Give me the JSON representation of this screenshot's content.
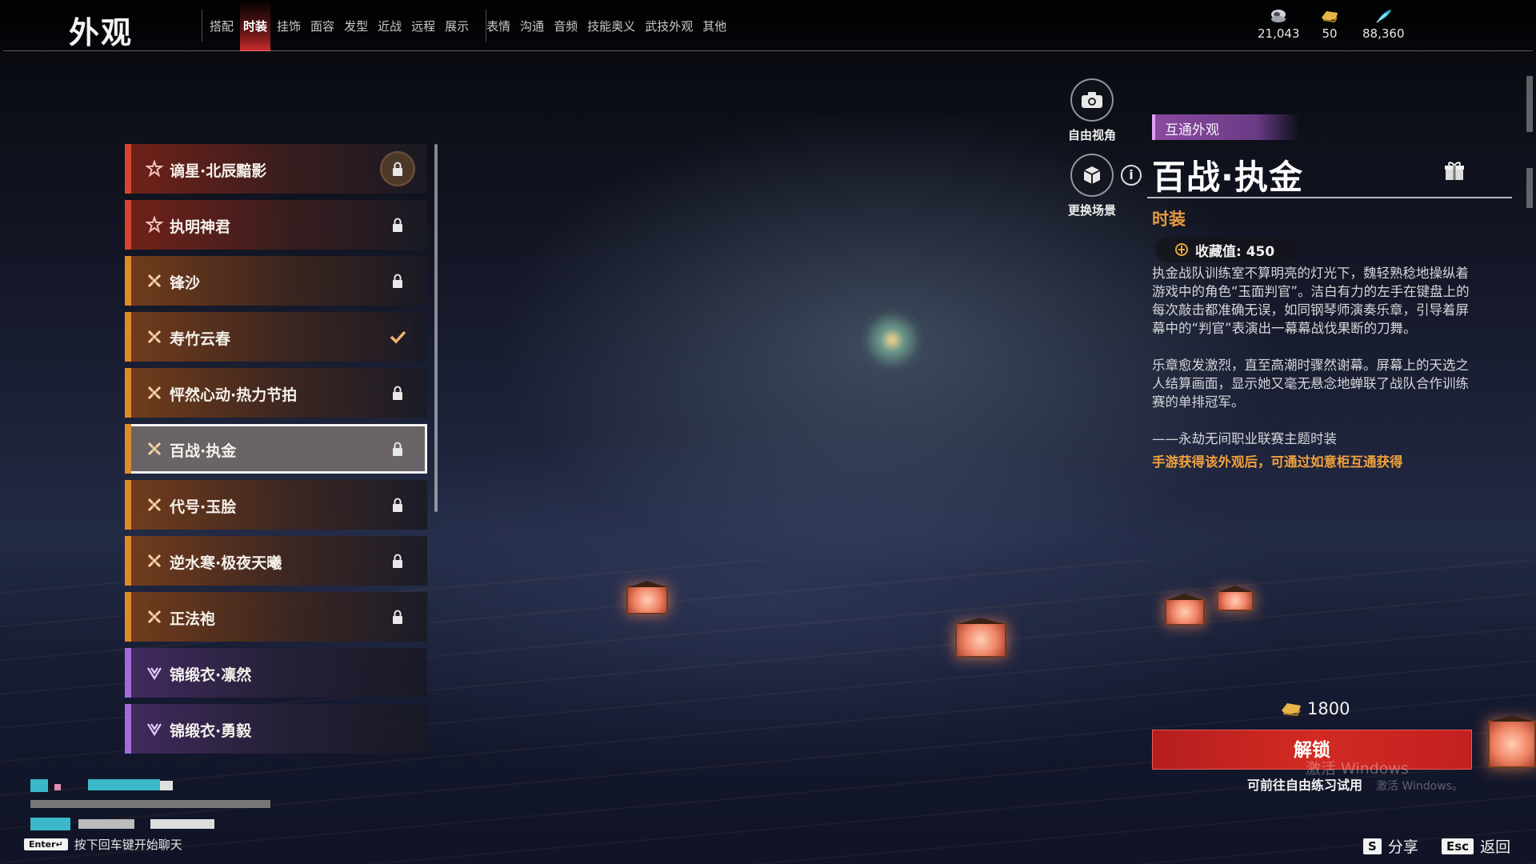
{
  "page_title": "外观",
  "tabs": [
    {
      "label": "搭配",
      "active": false
    },
    {
      "label": "时装",
      "active": true
    },
    {
      "label": "挂饰",
      "active": false
    },
    {
      "label": "面容",
      "active": false
    },
    {
      "label": "发型",
      "active": false
    },
    {
      "label": "近战",
      "active": false
    },
    {
      "label": "远程",
      "active": false
    },
    {
      "label": "展示",
      "active": false
    },
    {
      "label": "表情",
      "active": false
    },
    {
      "label": "沟通",
      "active": false
    },
    {
      "label": "音频",
      "active": false
    },
    {
      "label": "技能奥义",
      "active": false
    },
    {
      "label": "武技外观",
      "active": false
    },
    {
      "label": "其他",
      "active": false
    }
  ],
  "currencies": [
    {
      "icon": "coin-stack-icon",
      "value": "21,043"
    },
    {
      "icon": "gold-ingot-icon",
      "value": "50"
    },
    {
      "icon": "feather-icon",
      "value": "88,360"
    }
  ],
  "items": [
    {
      "name": "谪星·北辰黯影",
      "rarity": "red",
      "state": "locked-badge"
    },
    {
      "name": "执明神君",
      "rarity": "red",
      "state": "locked"
    },
    {
      "name": "锋沙",
      "rarity": "orange",
      "state": "locked"
    },
    {
      "name": "寿竹云春",
      "rarity": "orange",
      "state": "owned"
    },
    {
      "name": "怦然心动·热力节拍",
      "rarity": "orange",
      "state": "locked"
    },
    {
      "name": "百战·执金",
      "rarity": "orange",
      "state": "locked",
      "selected": true
    },
    {
      "name": "代号·玉脍",
      "rarity": "orange",
      "state": "locked"
    },
    {
      "name": "逆水寒·极夜天曦",
      "rarity": "orange",
      "state": "locked"
    },
    {
      "name": "正法袍",
      "rarity": "orange",
      "state": "locked"
    },
    {
      "name": "锦缎衣·凛然",
      "rarity": "purple",
      "state": "none"
    },
    {
      "name": "锦缎衣·勇毅",
      "rarity": "purple",
      "state": "none"
    }
  ],
  "side_buttons": {
    "free_view": "自由视角",
    "change_scene": "更换场景"
  },
  "detail": {
    "tag": "互通外观",
    "title": "百战·执金",
    "category": "时装",
    "collect_label": "收藏值: 450",
    "desc1": "执金战队训练室不算明亮的灯光下，魏轻熟稔地操纵着游戏中的角色“玉面判官”。洁白有力的左手在键盘上的每次敲击都准确无误，如同钢琴师演奏乐章，引导着屏幕中的“判官”表演出一幕幕战伐果断的刀舞。",
    "desc2": "乐章愈发激烈，直至高潮时骤然谢幕。屏幕上的天选之人结算画面，显示她又毫无悬念地蝉联了战队合作训练赛的单排冠军。",
    "quote": "——永劫无间职业联赛主题时装",
    "note": "手游获得该外观后，可通过如意柜互通获得"
  },
  "purchase": {
    "price": "1800",
    "unlock_label": "解锁",
    "trial_text": "可前往自由练习试用"
  },
  "watermark": {
    "line1": "激活 Windows",
    "line2": "激活 Windows。"
  },
  "bottom": {
    "chat_key": "Enter↵",
    "chat_hint": "按下回车键开始聊天",
    "share_key": "S",
    "share_label": "分享",
    "back_key": "Esc",
    "back_label": "返回"
  },
  "colors": {
    "accent_red": "#d22a22",
    "rarity_red": "#d9442e",
    "rarity_orange": "#e08a2c",
    "rarity_purple": "#a56ad8",
    "note_orange": "#f0a13e",
    "tag_purple": "#8b4a9e"
  }
}
